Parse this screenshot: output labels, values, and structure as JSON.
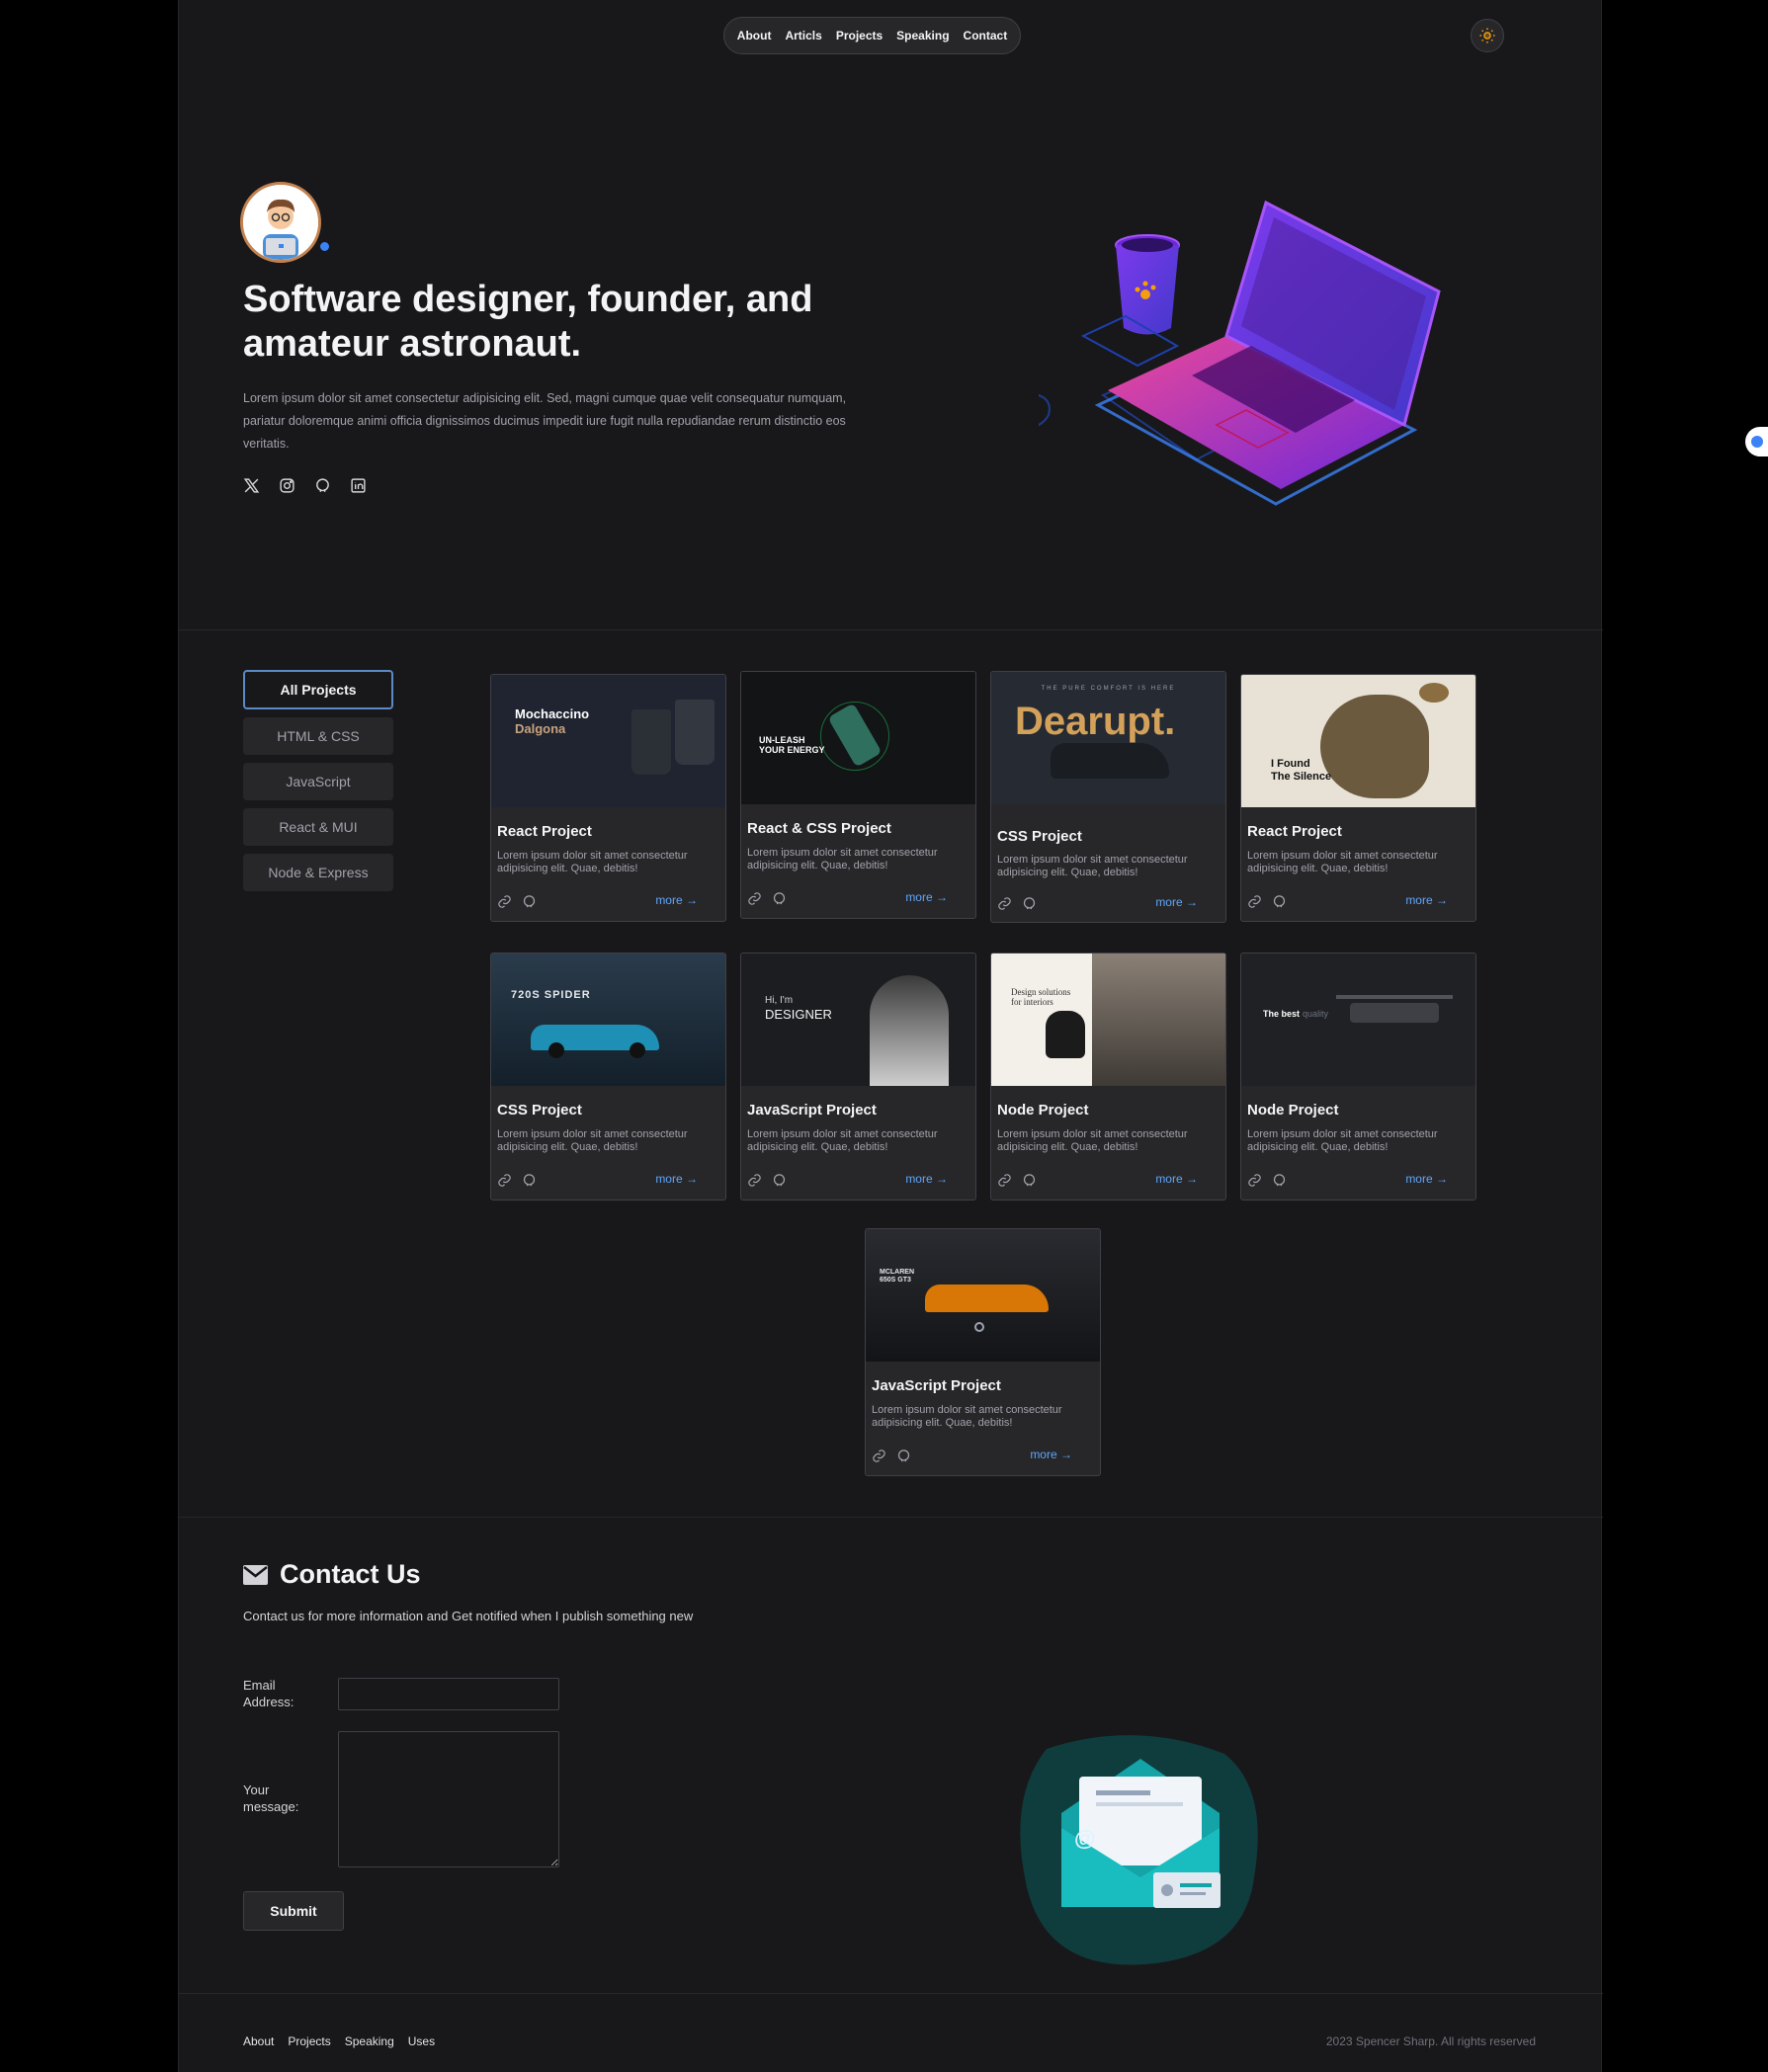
{
  "nav": {
    "items": [
      "About",
      "Articls",
      "Projects",
      "Speaking",
      "Contact"
    ]
  },
  "hero": {
    "title": "Software designer, founder, and amateur astronaut.",
    "description": "Lorem ipsum dolor sit amet consectetur adipisicing elit. Sed, magni cumque quae velit consequatur numquam, pariatur doloremque animi officia dignissimos ducimus impedit iure fugit nulla repudiandae rerum distinctio eos veritatis."
  },
  "filters": [
    "All Projects",
    "HTML & CSS",
    "JavaScript",
    "React & MUI",
    "Node & Express"
  ],
  "projects": [
    {
      "title": "React Project",
      "desc": "Lorem ipsum dolor sit amet consectetur adipisicing elit. Quae, debitis!",
      "more": "more",
      "thumb": {
        "line1": "Mochaccino",
        "line2": "Dalgona"
      }
    },
    {
      "title": "React & CSS Project",
      "desc": "Lorem ipsum dolor sit amet consectetur adipisicing elit. Quae, debitis!",
      "more": "more",
      "thumb": {
        "line1": "UN-LEASH",
        "line2": "YOUR ENERGY"
      }
    },
    {
      "title": "CSS Project",
      "desc": "Lorem ipsum dolor sit amet consectetur adipisicing elit. Quae, debitis!",
      "more": "more",
      "thumb": {
        "line1": "THE PURE COMFORT IS HERE",
        "line2": "Dearupt."
      }
    },
    {
      "title": "React Project",
      "desc": "Lorem ipsum dolor sit amet consectetur adipisicing elit. Quae, debitis!",
      "more": "more",
      "thumb": {
        "line1": "I Found",
        "line2": "The Silence"
      }
    },
    {
      "title": "CSS Project",
      "desc": "Lorem ipsum dolor sit amet consectetur adipisicing elit. Quae, debitis!",
      "more": "more",
      "thumb": {
        "line1": "720S SPIDER",
        "line2": ""
      }
    },
    {
      "title": "JavaScript Project",
      "desc": "Lorem ipsum dolor sit amet consectetur adipisicing elit. Quae, debitis!",
      "more": "more",
      "thumb": {
        "line1": "Hi, I'm",
        "line2": "DESIGNER"
      }
    },
    {
      "title": "Node Project",
      "desc": "Lorem ipsum dolor sit amet consectetur adipisicing elit. Quae, debitis!",
      "more": "more",
      "thumb": {
        "line1": "Design solutions",
        "line2": "for interiors"
      }
    },
    {
      "title": "Node Project",
      "desc": "Lorem ipsum dolor sit amet consectetur adipisicing elit. Quae, debitis!",
      "more": "more",
      "thumb": {
        "line1": "The best",
        "line2": "quality"
      }
    },
    {
      "title": "JavaScript Project",
      "desc": "Lorem ipsum dolor sit amet consectetur adipisicing elit. Quae, debitis!",
      "more": "more",
      "thumb": {
        "line1": "MCLAREN",
        "line2": "650S GT3"
      }
    }
  ],
  "contact": {
    "title": "Contact Us",
    "subtitle": "Contact us for more information and Get notified when I publish something new",
    "email_label": "Email Address:",
    "message_label": "Your message:",
    "submit": "Submit"
  },
  "footer": {
    "links": [
      "About",
      "Projects",
      "Speaking",
      "Uses"
    ],
    "copyright": "2023 Spencer Sharp. All rights reserved"
  },
  "colors": {
    "background": "#18181b",
    "card": "#27272a",
    "accent": "#60a5fa",
    "theme_icon": "#f59e0b"
  },
  "icons": [
    "sun-icon",
    "x-twitter-icon",
    "instagram-icon",
    "github-icon",
    "linkedin-icon",
    "link-icon",
    "mail-icon",
    "arrow-right-icon"
  ]
}
